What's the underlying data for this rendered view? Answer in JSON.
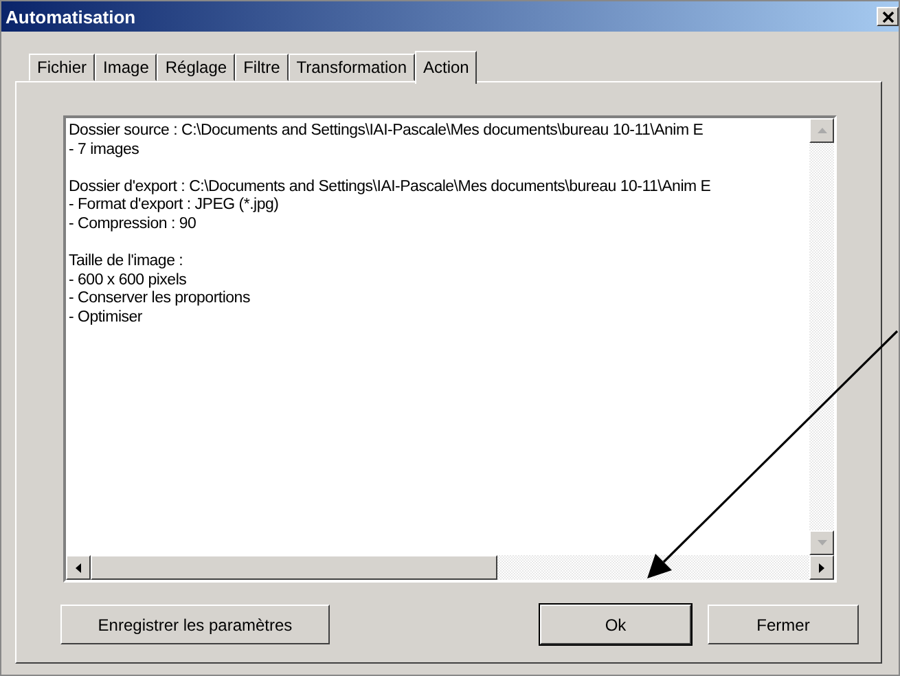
{
  "window": {
    "title": "Automatisation"
  },
  "tabs": [
    {
      "label": "Fichier",
      "selected": false
    },
    {
      "label": "Image",
      "selected": false
    },
    {
      "label": "Réglage",
      "selected": false
    },
    {
      "label": "Filtre",
      "selected": false
    },
    {
      "label": "Transformation",
      "selected": false
    },
    {
      "label": "Action",
      "selected": true
    }
  ],
  "summary": {
    "paragraphs": [
      {
        "lines": [
          "Dossier source : C:\\Documents and Settings\\IAI-Pascale\\Mes documents\\bureau 10-11\\Anim E",
          "- 7 images"
        ]
      },
      {
        "lines": [
          "Dossier d'export : C:\\Documents and Settings\\IAI-Pascale\\Mes documents\\bureau 10-11\\Anim E",
          "- Format d'export : JPEG (*.jpg)",
          "- Compression : 90"
        ]
      },
      {
        "lines": [
          "Taille de l'image :",
          "- 600 x 600 pixels",
          "- Conserver les proportions",
          "- Optimiser"
        ]
      }
    ]
  },
  "buttons": [
    {
      "label": "Enregistrer les paramètres",
      "default": false
    },
    {
      "label": "Ok",
      "default": true
    },
    {
      "label": "Fermer",
      "default": false
    }
  ]
}
